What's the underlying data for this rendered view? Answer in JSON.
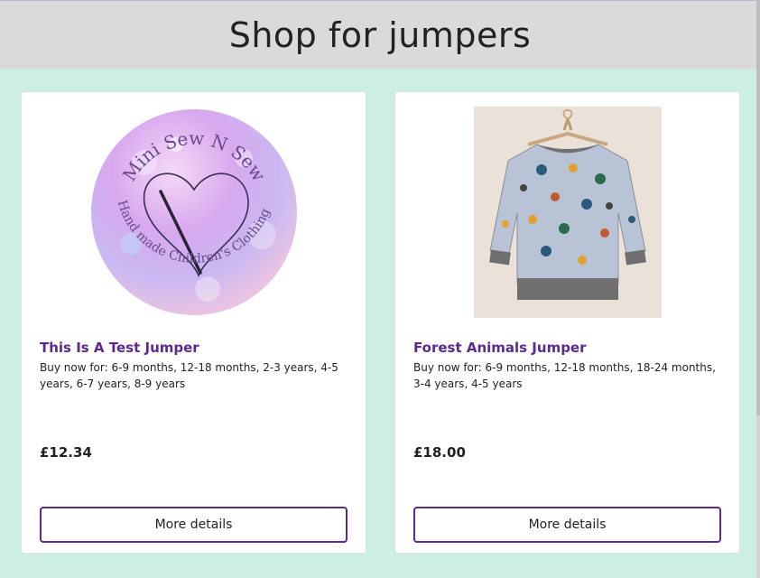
{
  "header": {
    "title": "Shop for jumpers"
  },
  "products": [
    {
      "title": "This Is A Test Jumper",
      "description": "Buy now for: 6-9 months, 12-18 months, 2-3 years, 4-5 years, 6-7 years, 8-9 years",
      "price": "£12.34",
      "button_label": "More details",
      "image": "mini-sew-n-sew-logo",
      "logo_top_text": "Mini Sew N Sew",
      "logo_bottom_text": "Hand made Children's Clothing"
    },
    {
      "title": "Forest Animals Jumper",
      "description": "Buy now for: 6-9 months, 12-18 months, 18-24 months, 3-4 years, 4-5 years",
      "price": "£18.00",
      "button_label": "More details",
      "image": "forest-animals-jumper-photo"
    }
  ],
  "colors": {
    "page_background": "#cdeee3",
    "header_background": "#dadada",
    "accent": "#5b2a8e"
  }
}
